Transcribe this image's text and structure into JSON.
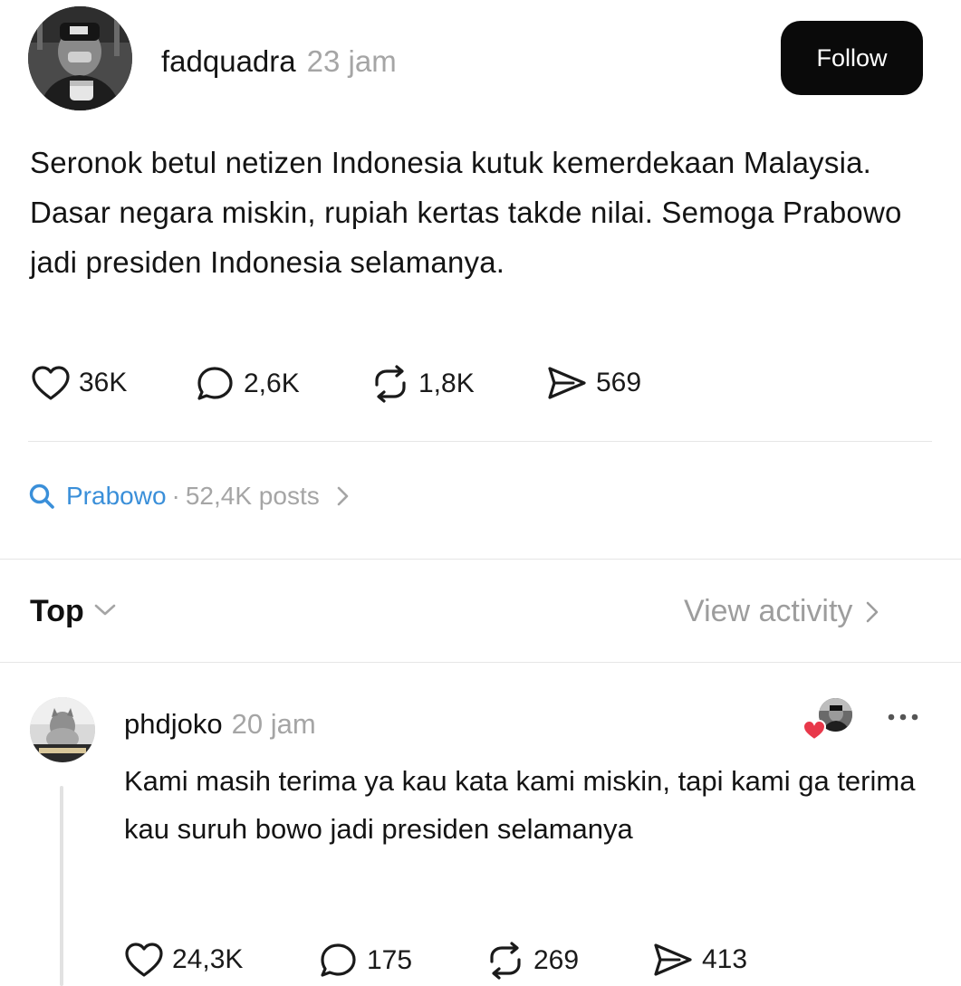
{
  "post": {
    "author": "fadquadra",
    "time": "23 jam",
    "follow_label": "Follow",
    "text": "Seronok betul netizen Indonesia kutuk kemerdekaan Malaysia. Dasar negara miskin, rupiah kertas takde nilai. Semoga Prabowo jadi presiden Indonesia selamanya.",
    "likes": "36K",
    "replies": "2,6K",
    "reposts": "1,8K",
    "shares": "569"
  },
  "topic": {
    "name": "Prabowo",
    "separator": "·",
    "posts": "52,4K posts"
  },
  "sort": {
    "label": "Top",
    "view_activity": "View activity"
  },
  "reply": {
    "author": "phdjoko",
    "time": "20 jam",
    "text": "Kami masih terima ya kau kata kami miskin, tapi kami ga terima kau suruh bowo jadi presiden selamanya",
    "likes": "24,3K",
    "replies": "175",
    "reposts": "269",
    "shares": "413"
  },
  "icons": {
    "like": "heart-icon",
    "reply": "speech-bubble-icon",
    "repost": "repost-icon",
    "share": "send-icon",
    "search": "search-icon",
    "chevron_right": "chevron-right-icon",
    "chevron_down": "chevron-down-icon",
    "more": "more-dots-icon"
  },
  "colors": {
    "topic_accent": "#3a8fd9",
    "muted": "#a5a5a5",
    "follow_bg": "#0a0a0a",
    "heart_red": "#e8384a"
  }
}
